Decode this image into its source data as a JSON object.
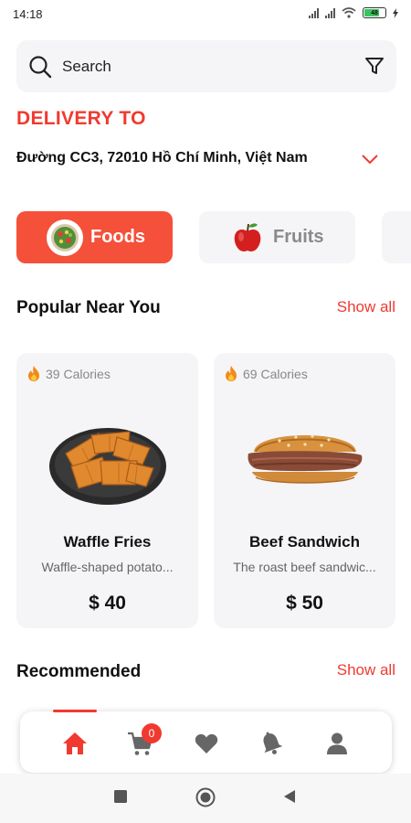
{
  "status": {
    "time": "14:18",
    "battery": "48"
  },
  "search": {
    "placeholder": "Search"
  },
  "delivery": {
    "label": "DELIVERY TO",
    "address": "Đường CC3, 72010 Hồ Chí Minh, Việt Nam"
  },
  "categories": [
    {
      "label": "Foods",
      "icon": "salad-bowl-icon",
      "selected": true
    },
    {
      "label": "Fruits",
      "icon": "apple-icon",
      "selected": false
    }
  ],
  "popular": {
    "title": "Popular Near You",
    "show_all": "Show all",
    "items": [
      {
        "calories": "39 Calories",
        "name": "Waffle Fries",
        "description": "Waffle-shaped potato...",
        "price": "$ 40",
        "icon": "waffle-fries-icon"
      },
      {
        "calories": "69 Calories",
        "name": "Beef Sandwich",
        "description": "The roast beef sandwic...",
        "price": "$ 50",
        "icon": "beef-sandwich-icon"
      }
    ]
  },
  "recommended": {
    "title": "Recommended",
    "show_all": "Show all"
  },
  "nav": {
    "items": [
      "home-icon",
      "cart-icon",
      "heart-icon",
      "bell-icon",
      "profile-icon"
    ],
    "active": "home",
    "cart_count": "0"
  },
  "colors": {
    "accent": "#f03a30",
    "accent_button": "#f4503a",
    "card_bg": "#f5f5f7"
  }
}
